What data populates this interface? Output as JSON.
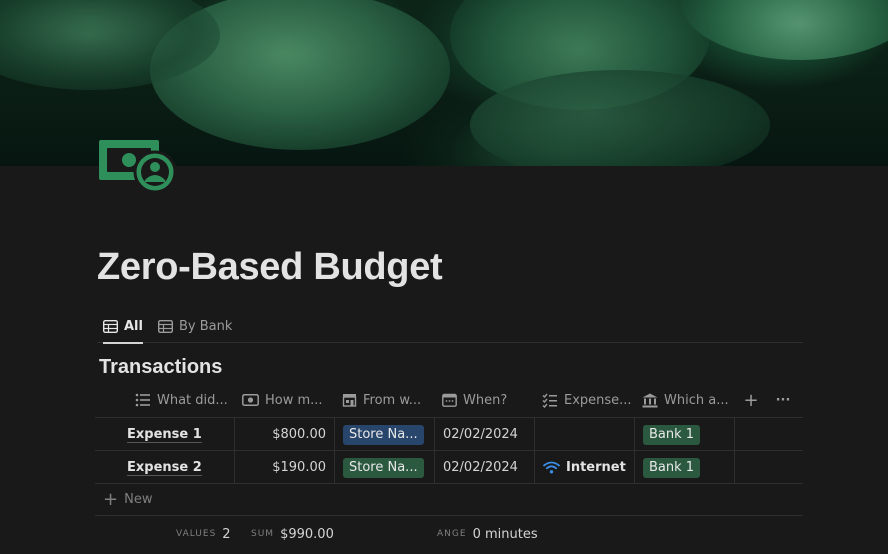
{
  "page": {
    "title": "Zero-Based Budget",
    "icon": "money-icon",
    "cover": "coins-cover-image"
  },
  "tabs": [
    {
      "label": "All",
      "icon": "table-icon",
      "active": true
    },
    {
      "label": "By Bank",
      "icon": "table-icon",
      "active": false
    }
  ],
  "database": {
    "title": "Transactions",
    "columns": [
      {
        "label": "What did...",
        "icon": "list-icon"
      },
      {
        "label": "How m...",
        "icon": "money-icon"
      },
      {
        "label": "From w...",
        "icon": "store-icon"
      },
      {
        "label": "When?",
        "icon": "calendar-icon"
      },
      {
        "label": "Expense...",
        "icon": "checklist-icon"
      },
      {
        "label": "Which a...",
        "icon": "bank-icon"
      }
    ],
    "add_column": "+",
    "more": "···",
    "rows": [
      {
        "name": "Expense 1",
        "amount": "$800.00",
        "store": "Store Na...",
        "when": "02/02/2024",
        "expense": "",
        "account": "Bank 1"
      },
      {
        "name": "Expense 2",
        "amount": "$190.00",
        "store": "Store Na...",
        "when": "02/02/2024",
        "expense": "Internet",
        "account": "Bank 1"
      }
    ],
    "new_label": "New"
  },
  "calculations": [
    {
      "label": "VALUES",
      "value": "2"
    },
    {
      "label": "SUM",
      "value": "$990.00"
    },
    {
      "label": "ANGE",
      "value": "0 minutes"
    }
  ],
  "colors": {
    "background": "#191919",
    "accent_green": "#2f8f5b",
    "tag_blue": "#28456c",
    "tag_green": "#2b593f",
    "wifi_blue": "#3a8ee6"
  }
}
